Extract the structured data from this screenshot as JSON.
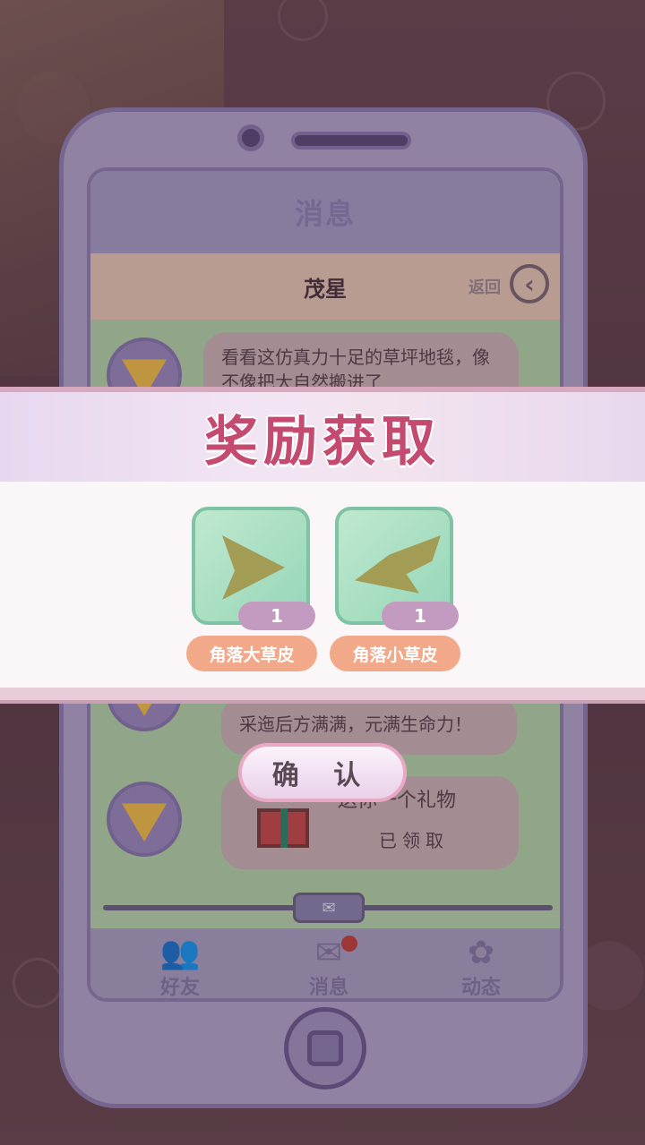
{
  "phone": {
    "screen_title": "消息",
    "contact_name": "茂星",
    "back_label": "返回",
    "back_icon": "chevron-left-icon"
  },
  "chat": {
    "message1": "看看这仿真力十足的草坪地毯，像不像把大自然搬进了",
    "message2": "采迤后方满满，元满生命力！",
    "gift_text": "送你一个礼物",
    "gift_status": "已领取"
  },
  "tabs": [
    {
      "label": "好友",
      "icon": "friends-icon"
    },
    {
      "label": "消息",
      "icon": "mail-icon"
    },
    {
      "label": "动态",
      "icon": "moments-icon"
    }
  ],
  "reward": {
    "title": "奖励获取",
    "items": [
      {
        "name": "角落大草皮",
        "count": "1"
      },
      {
        "name": "角落小草皮",
        "count": "1"
      }
    ],
    "confirm_label": "确 认"
  }
}
